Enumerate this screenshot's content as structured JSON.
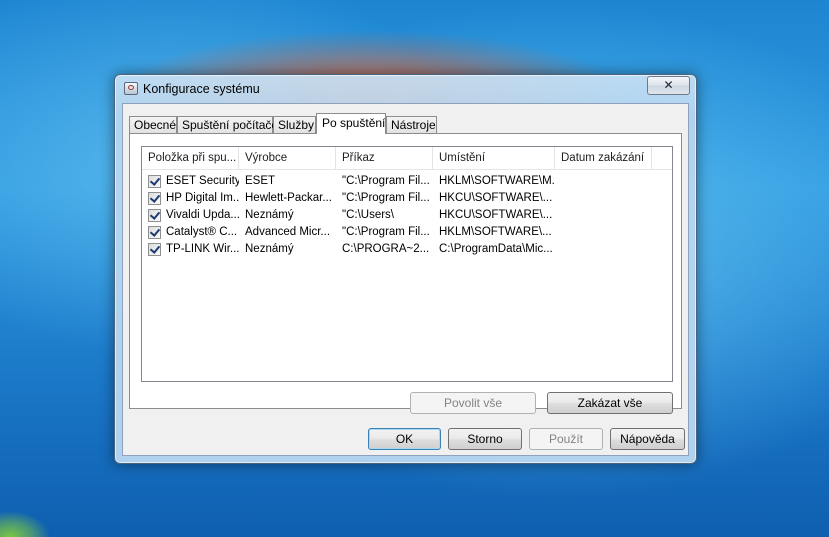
{
  "window": {
    "title": "Konfigurace systému",
    "close_label": "✕"
  },
  "tabs": [
    {
      "label": "Obecné",
      "active": false
    },
    {
      "label": "Spuštění počítače",
      "active": false
    },
    {
      "label": "Služby",
      "active": false
    },
    {
      "label": "Po spuštění",
      "active": true
    },
    {
      "label": "Nástroje",
      "active": false
    }
  ],
  "startup_list": {
    "columns": [
      "Položka při spu...",
      "Výrobce",
      "Příkaz",
      "Umístění",
      "Datum zakázání"
    ],
    "rows": [
      {
        "checked": true,
        "item": "ESET Security",
        "vendor": "ESET",
        "command": "\"C:\\Program Fil...",
        "location": "HKLM\\SOFTWARE\\M...",
        "disabled_date": ""
      },
      {
        "checked": true,
        "item": "HP Digital Im...",
        "vendor": "Hewlett-Packar...",
        "command": "\"C:\\Program Fil...",
        "location": "HKCU\\SOFTWARE\\...",
        "disabled_date": ""
      },
      {
        "checked": true,
        "item": "Vivaldi Upda...",
        "vendor": "Neznámý",
        "command": "\"C:\\Users\\",
        "location": "HKCU\\SOFTWARE\\...",
        "disabled_date": ""
      },
      {
        "checked": true,
        "item": "Catalyst® C...",
        "vendor": "Advanced Micr...",
        "command": "\"C:\\Program Fil...",
        "location": "HKLM\\SOFTWARE\\...",
        "disabled_date": ""
      },
      {
        "checked": true,
        "item": "TP-LINK Wir...",
        "vendor": "Neznámý",
        "command": "C:\\PROGRA~2...",
        "location": "C:\\ProgramData\\Mic...",
        "disabled_date": ""
      }
    ]
  },
  "buttons": {
    "enable_all": "Povolit vše",
    "disable_all": "Zakázat vše",
    "ok": "OK",
    "cancel": "Storno",
    "apply": "Použít",
    "help": "Nápověda"
  },
  "colors": {
    "desktop": "#1d86d2",
    "window_frame": "#bedaf2",
    "dialog_face": "#f0f0f0",
    "default_button_border": "#3c7fb1"
  },
  "icons": {
    "window_icon": "msconfig-icon",
    "close": "close-icon",
    "checkbox": "checkmark-icon"
  }
}
